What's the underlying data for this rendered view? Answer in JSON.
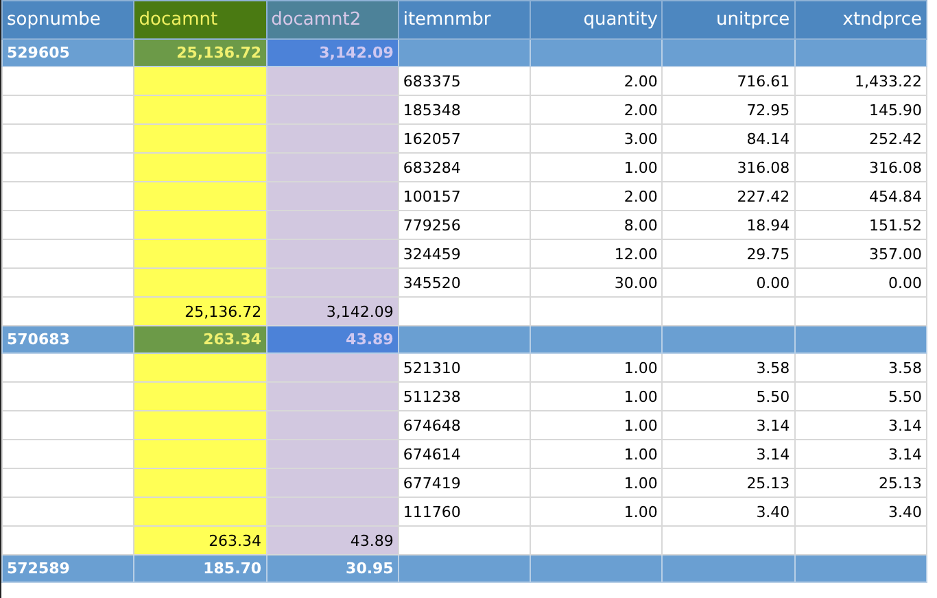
{
  "columns": [
    {
      "label": "sopnumbe",
      "kind": "key"
    },
    {
      "label": "docamnt",
      "kind": "doc"
    },
    {
      "label": "docamnt2",
      "kind": "doc2"
    },
    {
      "label": "itemnmbr",
      "kind": "text"
    },
    {
      "label": "quantity",
      "kind": "num"
    },
    {
      "label": "unitprce",
      "kind": "num"
    },
    {
      "label": "xtndprce",
      "kind": "num"
    }
  ],
  "groups": [
    {
      "sopnumbe": "529605",
      "docamnt": "25,136.72",
      "docamnt2": "3,142.09",
      "tinted": true,
      "items": [
        {
          "itemnmbr": "683375",
          "quantity": "2.00",
          "unitprce": "716.61",
          "xtndprce": "1,433.22"
        },
        {
          "itemnmbr": "185348",
          "quantity": "2.00",
          "unitprce": "72.95",
          "xtndprce": "145.90"
        },
        {
          "itemnmbr": "162057",
          "quantity": "3.00",
          "unitprce": "84.14",
          "xtndprce": "252.42"
        },
        {
          "itemnmbr": "683284",
          "quantity": "1.00",
          "unitprce": "316.08",
          "xtndprce": "316.08"
        },
        {
          "itemnmbr": "100157",
          "quantity": "2.00",
          "unitprce": "227.42",
          "xtndprce": "454.84"
        },
        {
          "itemnmbr": "779256",
          "quantity": "8.00",
          "unitprce": "18.94",
          "xtndprce": "151.52"
        },
        {
          "itemnmbr": "324459",
          "quantity": "12.00",
          "unitprce": "29.75",
          "xtndprce": "357.00"
        },
        {
          "itemnmbr": "345520",
          "quantity": "30.00",
          "unitprce": "0.00",
          "xtndprce": "0.00"
        }
      ],
      "totals": {
        "docamnt": "25,136.72",
        "docamnt2": "3,142.09"
      }
    },
    {
      "sopnumbe": "570683",
      "docamnt": "263.34",
      "docamnt2": "43.89",
      "tinted": true,
      "items": [
        {
          "itemnmbr": "521310",
          "quantity": "1.00",
          "unitprce": "3.58",
          "xtndprce": "3.58"
        },
        {
          "itemnmbr": "511238",
          "quantity": "1.00",
          "unitprce": "5.50",
          "xtndprce": "5.50"
        },
        {
          "itemnmbr": "674648",
          "quantity": "1.00",
          "unitprce": "3.14",
          "xtndprce": "3.14"
        },
        {
          "itemnmbr": "674614",
          "quantity": "1.00",
          "unitprce": "3.14",
          "xtndprce": "3.14"
        },
        {
          "itemnmbr": "677419",
          "quantity": "1.00",
          "unitprce": "25.13",
          "xtndprce": "25.13"
        },
        {
          "itemnmbr": "111760",
          "quantity": "1.00",
          "unitprce": "3.40",
          "xtndprce": "3.40"
        }
      ],
      "totals": {
        "docamnt": "263.34",
        "docamnt2": "43.89"
      }
    },
    {
      "sopnumbe": "572589",
      "docamnt": "185.70",
      "docamnt2": "30.95",
      "tinted": false
    }
  ]
}
